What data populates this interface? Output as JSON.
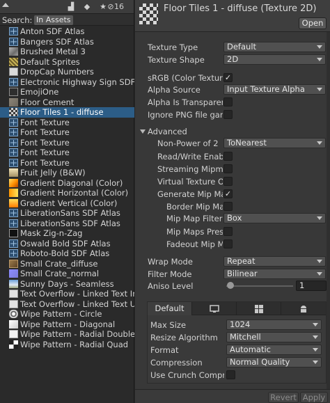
{
  "project": {
    "count_label": "16",
    "search_label": "Search:",
    "search_scope": "In Assets",
    "assets": [
      {
        "name": "Anton SDF Atlas",
        "thumb": "atlas"
      },
      {
        "name": "Bangers SDF Atlas",
        "thumb": "atlas"
      },
      {
        "name": "Brushed Metal 3",
        "thumb": "metal"
      },
      {
        "name": "Default Sprites",
        "thumb": "sprites"
      },
      {
        "name": "DropCap Numbers",
        "thumb": "dropcap"
      },
      {
        "name": "Electronic Highway Sign SDF Atlas",
        "thumb": "atlas"
      },
      {
        "name": "EmojiOne",
        "thumb": "emoji"
      },
      {
        "name": "Floor Cement",
        "thumb": "cement"
      },
      {
        "name": "Floor Tiles 1 - diffuse",
        "thumb": "floor",
        "selected": true
      },
      {
        "name": "Font Texture",
        "thumb": "atlas"
      },
      {
        "name": "Font Texture",
        "thumb": "atlas"
      },
      {
        "name": "Font Texture",
        "thumb": "atlas"
      },
      {
        "name": "Font Texture",
        "thumb": "atlas"
      },
      {
        "name": "Font Texture",
        "thumb": "atlas"
      },
      {
        "name": "Fruit Jelly (B&W)",
        "thumb": "jelly"
      },
      {
        "name": "Gradient Diagonal (Color)",
        "thumb": "grad-diag"
      },
      {
        "name": "Gradient Horizontal (Color)",
        "thumb": "grad-horz"
      },
      {
        "name": "Gradient Vertical (Color)",
        "thumb": "grad-vert"
      },
      {
        "name": "LiberationSans SDF Atlas",
        "thumb": "atlas"
      },
      {
        "name": "LiberationSans SDF Atlas",
        "thumb": "atlas"
      },
      {
        "name": "Mask Zig-n-Zag",
        "thumb": "mask"
      },
      {
        "name": "Oswald Bold SDF Atlas",
        "thumb": "atlas"
      },
      {
        "name": "Roboto-Bold SDF Atlas",
        "thumb": "atlas"
      },
      {
        "name": "Small Crate_diffuse",
        "thumb": "crate"
      },
      {
        "name": "Small Crate_normal",
        "thumb": "crate-n"
      },
      {
        "name": "Sunny Days - Seamless",
        "thumb": "sunny"
      },
      {
        "name": "Text Overflow - Linked Text Image",
        "thumb": "overflow"
      },
      {
        "name": "Text Overflow - Linked Text UI S",
        "thumb": "overflow"
      },
      {
        "name": "Wipe Pattern - Circle",
        "thumb": "circle"
      },
      {
        "name": "Wipe Pattern - Diagonal",
        "thumb": "wipe-diag"
      },
      {
        "name": "Wipe Pattern - Radial Double",
        "thumb": "wipe-rd"
      },
      {
        "name": "Wipe Pattern - Radial Quad",
        "thumb": "wipe-rq"
      }
    ]
  },
  "inspector": {
    "title": "Floor Tiles 1 - diffuse (Texture 2D)",
    "open_label": "Open",
    "texture_type": {
      "label": "Texture Type",
      "value": "Default"
    },
    "texture_shape": {
      "label": "Texture Shape",
      "value": "2D"
    },
    "srgb": {
      "label": "sRGB (Color Texture)",
      "checked": true
    },
    "alpha_source": {
      "label": "Alpha Source",
      "value": "Input Texture Alpha"
    },
    "alpha_transparency": {
      "label": "Alpha Is Transparency",
      "checked": false
    },
    "ignore_png_gamma": {
      "label": "Ignore PNG file gamma",
      "checked": false
    },
    "advanced": {
      "label": "Advanced",
      "expanded": true
    },
    "npot": {
      "label": "Non-Power of 2",
      "value": "ToNearest"
    },
    "read_write": {
      "label": "Read/Write Enabled",
      "checked": false
    },
    "streaming_mipmaps": {
      "label": "Streaming Mipmaps",
      "checked": false
    },
    "virtual_texture": {
      "label": "Virtual Texture Only",
      "checked": false
    },
    "generate_mipmaps": {
      "label": "Generate Mip Maps",
      "checked": true
    },
    "border_mipmaps": {
      "label": "Border Mip Maps",
      "checked": false
    },
    "mipmap_filtering": {
      "label": "Mip Map Filtering",
      "value": "Box"
    },
    "mipmaps_preserve": {
      "label": "Mip Maps Preserve Coverage",
      "checked": false
    },
    "fadeout_mipmaps": {
      "label": "Fadeout Mip Maps",
      "checked": false
    },
    "wrap_mode": {
      "label": "Wrap Mode",
      "value": "Repeat"
    },
    "filter_mode": {
      "label": "Filter Mode",
      "value": "Bilinear"
    },
    "aniso_level": {
      "label": "Aniso Level",
      "value": "1",
      "level": 1,
      "min": 0,
      "max": 16
    },
    "platform": {
      "tabs": [
        {
          "label": "Default",
          "icon": "",
          "active": true
        },
        {
          "label": "",
          "icon": "monitor-icon"
        },
        {
          "label": "",
          "icon": "windows-icon"
        },
        {
          "label": "",
          "icon": "android-icon"
        }
      ],
      "max_size": {
        "label": "Max Size",
        "value": "1024"
      },
      "resize_algorithm": {
        "label": "Resize Algorithm",
        "value": "Mitchell"
      },
      "format": {
        "label": "Format",
        "value": "Automatic"
      },
      "compression": {
        "label": "Compression",
        "value": "Normal Quality"
      },
      "use_crunch": {
        "label": "Use Crunch Compression",
        "checked": false
      }
    },
    "revert_label": "Revert",
    "apply_label": "Apply"
  },
  "colors": {
    "selection": "#2c5d87",
    "panel": "#383838",
    "field": "#505050"
  }
}
